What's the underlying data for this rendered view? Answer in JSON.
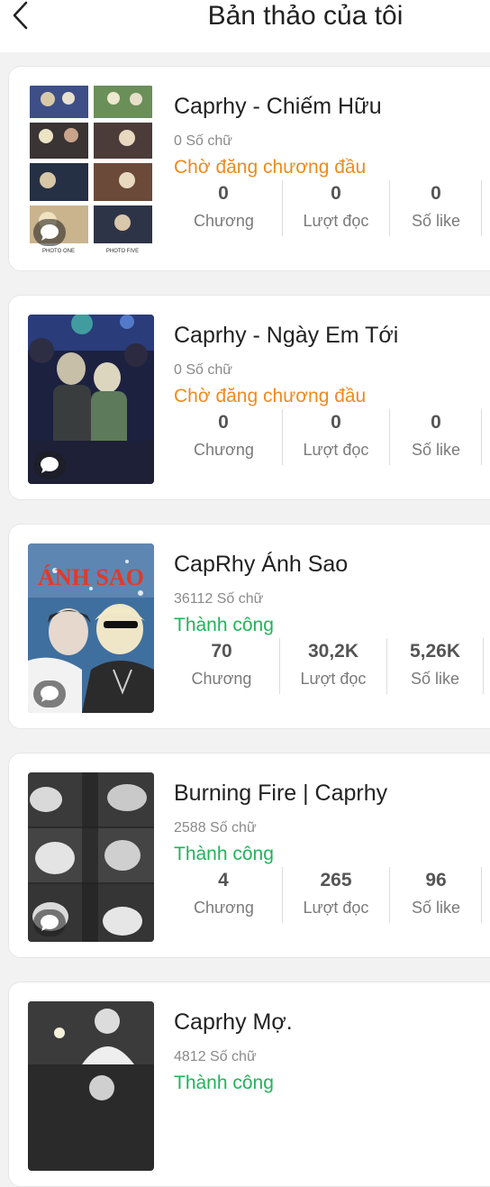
{
  "header": {
    "title": "Bản thảo của tôi"
  },
  "stat_labels": {
    "chapters": "Chương",
    "reads": "Lượt đọc",
    "likes": "Số like"
  },
  "stories": [
    {
      "title": "Caprhy - Chiếm Hữu",
      "words": "0 Số chữ",
      "status": "Chờ đăng chương đầu",
      "status_type": "pending",
      "chapters": "0",
      "reads": "0",
      "likes": "0",
      "cover_caption_left": "PHOTO ONE",
      "cover_caption_right": "PHOTO FIVE"
    },
    {
      "title": "Caprhy - Ngày Em Tới",
      "words": "0 Số chữ",
      "status": "Chờ đăng chương đầu",
      "status_type": "pending",
      "chapters": "0",
      "reads": "0",
      "likes": "0"
    },
    {
      "title": "CapRhy Ánh Sao",
      "words": "36112 Số chữ",
      "status": "Thành công",
      "status_type": "ok",
      "chapters": "70",
      "reads": "30,2K",
      "likes": "5,26K",
      "cover_text": "ÁNH SAO"
    },
    {
      "title": "Burning Fire | Caprhy",
      "words": "2588 Số chữ",
      "status": "Thành công",
      "status_type": "ok",
      "chapters": "4",
      "reads": "265",
      "likes": "96"
    },
    {
      "title": "Caprhy Mợ.",
      "words": "4812 Số chữ",
      "status": "Thành công",
      "status_type": "ok"
    }
  ],
  "icons": {
    "back": "chevron-left-icon",
    "comment": "comment-bubble-icon"
  },
  "colors": {
    "pending": "#f08a1c",
    "success": "#22b35a"
  }
}
